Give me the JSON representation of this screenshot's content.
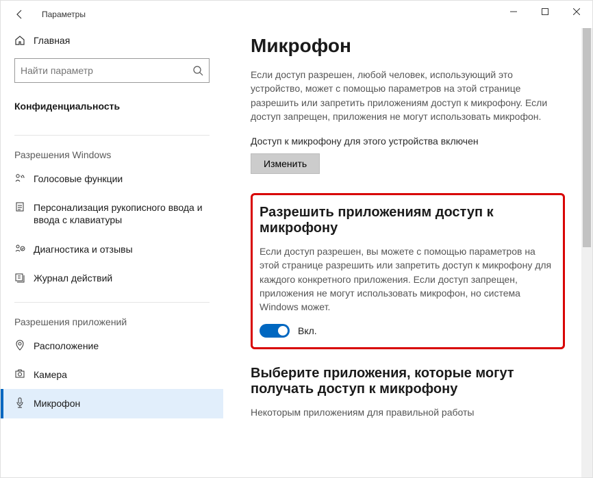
{
  "window": {
    "title": "Параметры"
  },
  "sidebar": {
    "home": "Главная",
    "search_placeholder": "Найти параметр",
    "category": "Конфиденциальность",
    "section_windows": "Разрешения Windows",
    "section_apps": "Разрешения приложений",
    "items_windows": [
      {
        "label": "Голосовые функции"
      },
      {
        "label": "Персонализация рукописного ввода и ввода с клавиатуры"
      },
      {
        "label": "Диагностика и отзывы"
      },
      {
        "label": "Журнал действий"
      }
    ],
    "items_apps": [
      {
        "label": "Расположение"
      },
      {
        "label": "Камера"
      },
      {
        "label": "Микрофон"
      }
    ]
  },
  "main": {
    "heading": "Микрофон",
    "intro": "Если доступ разрешен, любой человек, использующий это устройство, может с помощью параметров на этой странице разрешить или запретить приложениям доступ к микрофону. Если доступ запрещен, приложения не могут использовать микрофон.",
    "device_status": "Доступ к микрофону для этого устройства включен",
    "change_btn": "Изменить",
    "allow_heading": "Разрешить приложениям доступ к микрофону",
    "allow_desc": "Если доступ разрешен, вы можете с помощью параметров на этой странице разрешить или запретить доступ к микрофону для каждого конкретного приложения. Если доступ запрещен, приложения не могут использовать микрофон, но система Windows может.",
    "toggle_state": "Вкл.",
    "choose_heading": "Выберите приложения, которые могут получать доступ к микрофону",
    "choose_desc": "Некоторым приложениям для правильной работы"
  }
}
